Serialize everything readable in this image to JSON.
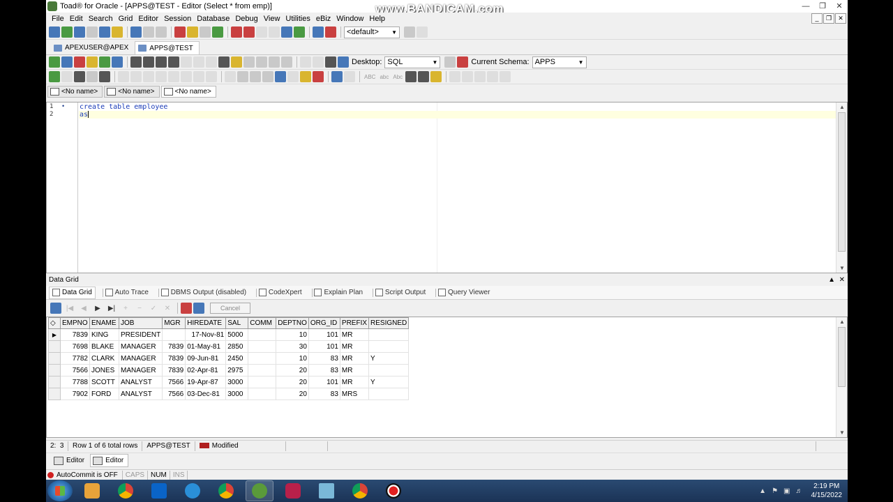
{
  "window": {
    "title": "Toad® for Oracle - [APPS@TEST - Editor (Select * from emp)]",
    "watermark": "www.BANDICAM.com"
  },
  "menu": [
    "File",
    "Edit",
    "Search",
    "Grid",
    "Editor",
    "Session",
    "Database",
    "Debug",
    "View",
    "Utilities",
    "eBiz",
    "Window",
    "Help"
  ],
  "toolbar1": {
    "profile_value": "<default>"
  },
  "connection_tabs": [
    {
      "label": "APEXUSER@APEX",
      "active": false
    },
    {
      "label": "APPS@TEST",
      "active": true
    }
  ],
  "toolbar2": {
    "desktop_label": "Desktop:",
    "desktop_value": "SQL",
    "schema_label": "Current Schema:",
    "schema_value": "APPS"
  },
  "toolbar3": {
    "case_labels": [
      "ABC",
      "abc",
      "Abc"
    ]
  },
  "editor_tabs": [
    {
      "label": "<No name>",
      "active": false
    },
    {
      "label": "<No name>",
      "active": false
    },
    {
      "label": "<No name>",
      "active": true
    }
  ],
  "editor": {
    "lines": [
      {
        "num": "1",
        "text": "create table employee"
      },
      {
        "num": "2",
        "text": "as"
      }
    ]
  },
  "data_grid": {
    "panel_title": "Data Grid",
    "tabs": [
      {
        "label": "Data Grid",
        "active": true
      },
      {
        "label": "Auto Trace",
        "active": false
      },
      {
        "label": "DBMS Output (disabled)",
        "active": false
      },
      {
        "label": "CodeXpert",
        "active": false
      },
      {
        "label": "Explain Plan",
        "active": false
      },
      {
        "label": "Script Output",
        "active": false
      },
      {
        "label": "Query Viewer",
        "active": false
      }
    ],
    "cancel_label": "Cancel",
    "columns": [
      "EMPNO",
      "ENAME",
      "JOB",
      "MGR",
      "HIREDATE",
      "SAL",
      "COMM",
      "DEPTNO",
      "ORG_ID",
      "PREFIX",
      "RESIGNED"
    ],
    "rows": [
      [
        "7839",
        "KING",
        "PRESIDENT",
        "",
        "17-Nov-81",
        "5000",
        "",
        "10",
        "101",
        "MR",
        ""
      ],
      [
        "7698",
        "BLAKE",
        "MANAGER",
        "7839",
        "01-May-81",
        "2850",
        "",
        "30",
        "101",
        "MR",
        ""
      ],
      [
        "7782",
        "CLARK",
        "MANAGER",
        "7839",
        "09-Jun-81",
        "2450",
        "",
        "10",
        "83",
        "MR",
        "Y"
      ],
      [
        "7566",
        "JONES",
        "MANAGER",
        "7839",
        "02-Apr-81",
        "2975",
        "",
        "20",
        "83",
        "MR",
        ""
      ],
      [
        "7788",
        "SCOTT",
        "ANALYST",
        "7566",
        "19-Apr-87",
        "3000",
        "",
        "20",
        "101",
        "MR",
        "Y"
      ],
      [
        "7902",
        "FORD",
        "ANALYST",
        "7566",
        "03-Dec-81",
        "3000",
        "",
        "20",
        "83",
        "MRS",
        ""
      ]
    ]
  },
  "status": {
    "position": "2:  3",
    "rows_info": "Row 1 of 6 total rows",
    "connection": "APPS@TEST",
    "modified": "Modified"
  },
  "window_tabs": [
    {
      "label": "Editor",
      "active": false
    },
    {
      "label": "Editor",
      "active": true
    }
  ],
  "bottom_status": {
    "autocommit": "AutoCommit is OFF",
    "caps": "CAPS",
    "num": "NUM",
    "ins": "INS"
  },
  "taskbar": {
    "time": "2:19 PM",
    "date": "4/15/2022"
  }
}
